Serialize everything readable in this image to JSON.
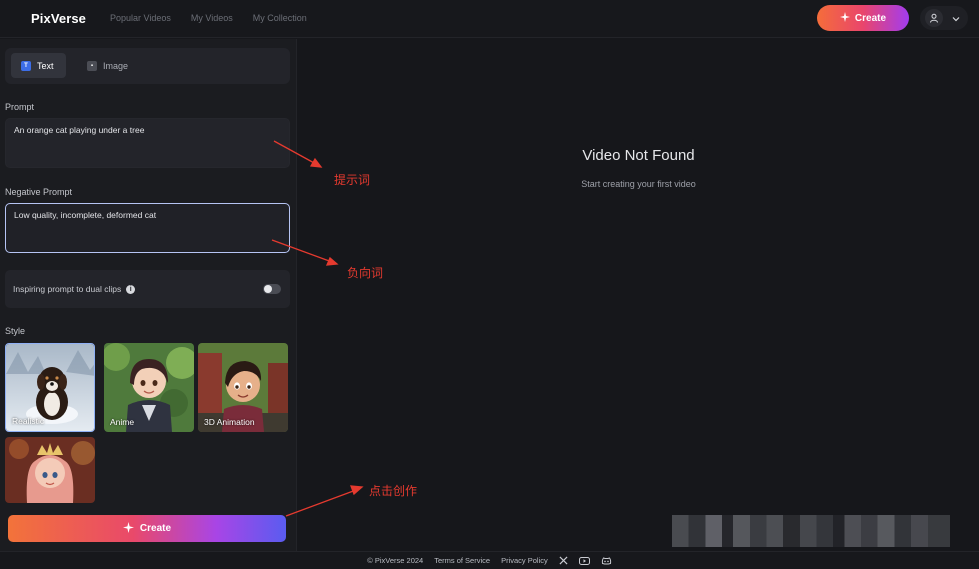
{
  "header": {
    "logo": "PixVerse",
    "nav": [
      "Popular Videos",
      "My Videos",
      "My Collection"
    ],
    "create_label": "Create"
  },
  "left_panel": {
    "tabs": [
      {
        "label": "Text",
        "icon": "text-icon",
        "active": true
      },
      {
        "label": "Image",
        "icon": "image-icon",
        "active": false
      }
    ],
    "prompt_label": "Prompt",
    "prompt_value": "An orange cat playing under a tree",
    "negative_label": "Negative Prompt",
    "negative_value": "Low quality, incomplete, deformed cat",
    "inspire_label": "Inspiring prompt to dual clips",
    "inspire_enabled": false,
    "style_label": "Style",
    "styles": [
      {
        "label": "Realistic",
        "selected": true
      },
      {
        "label": "Anime",
        "selected": false
      },
      {
        "label": "3D Animation",
        "selected": false
      },
      {
        "label": "",
        "selected": false
      }
    ],
    "create_label": "Create"
  },
  "main": {
    "empty_title": "Video Not Found",
    "empty_subtitle": "Start creating your first video"
  },
  "annotations": {
    "prompt": "提示词",
    "negative": "负向词",
    "create": "点击创作"
  },
  "footer": {
    "copyright": "© PixVerse 2024",
    "terms": "Terms of Service",
    "privacy": "Privacy Policy",
    "social": [
      "x-icon",
      "youtube-icon",
      "discord-icon"
    ]
  },
  "colors": {
    "accent_start": "#f56d3a",
    "accent_mid": "#e9456c",
    "accent_end": "#a23cf0",
    "annotation_red": "#e53a2f",
    "selected_border": "#8fb0f5"
  }
}
